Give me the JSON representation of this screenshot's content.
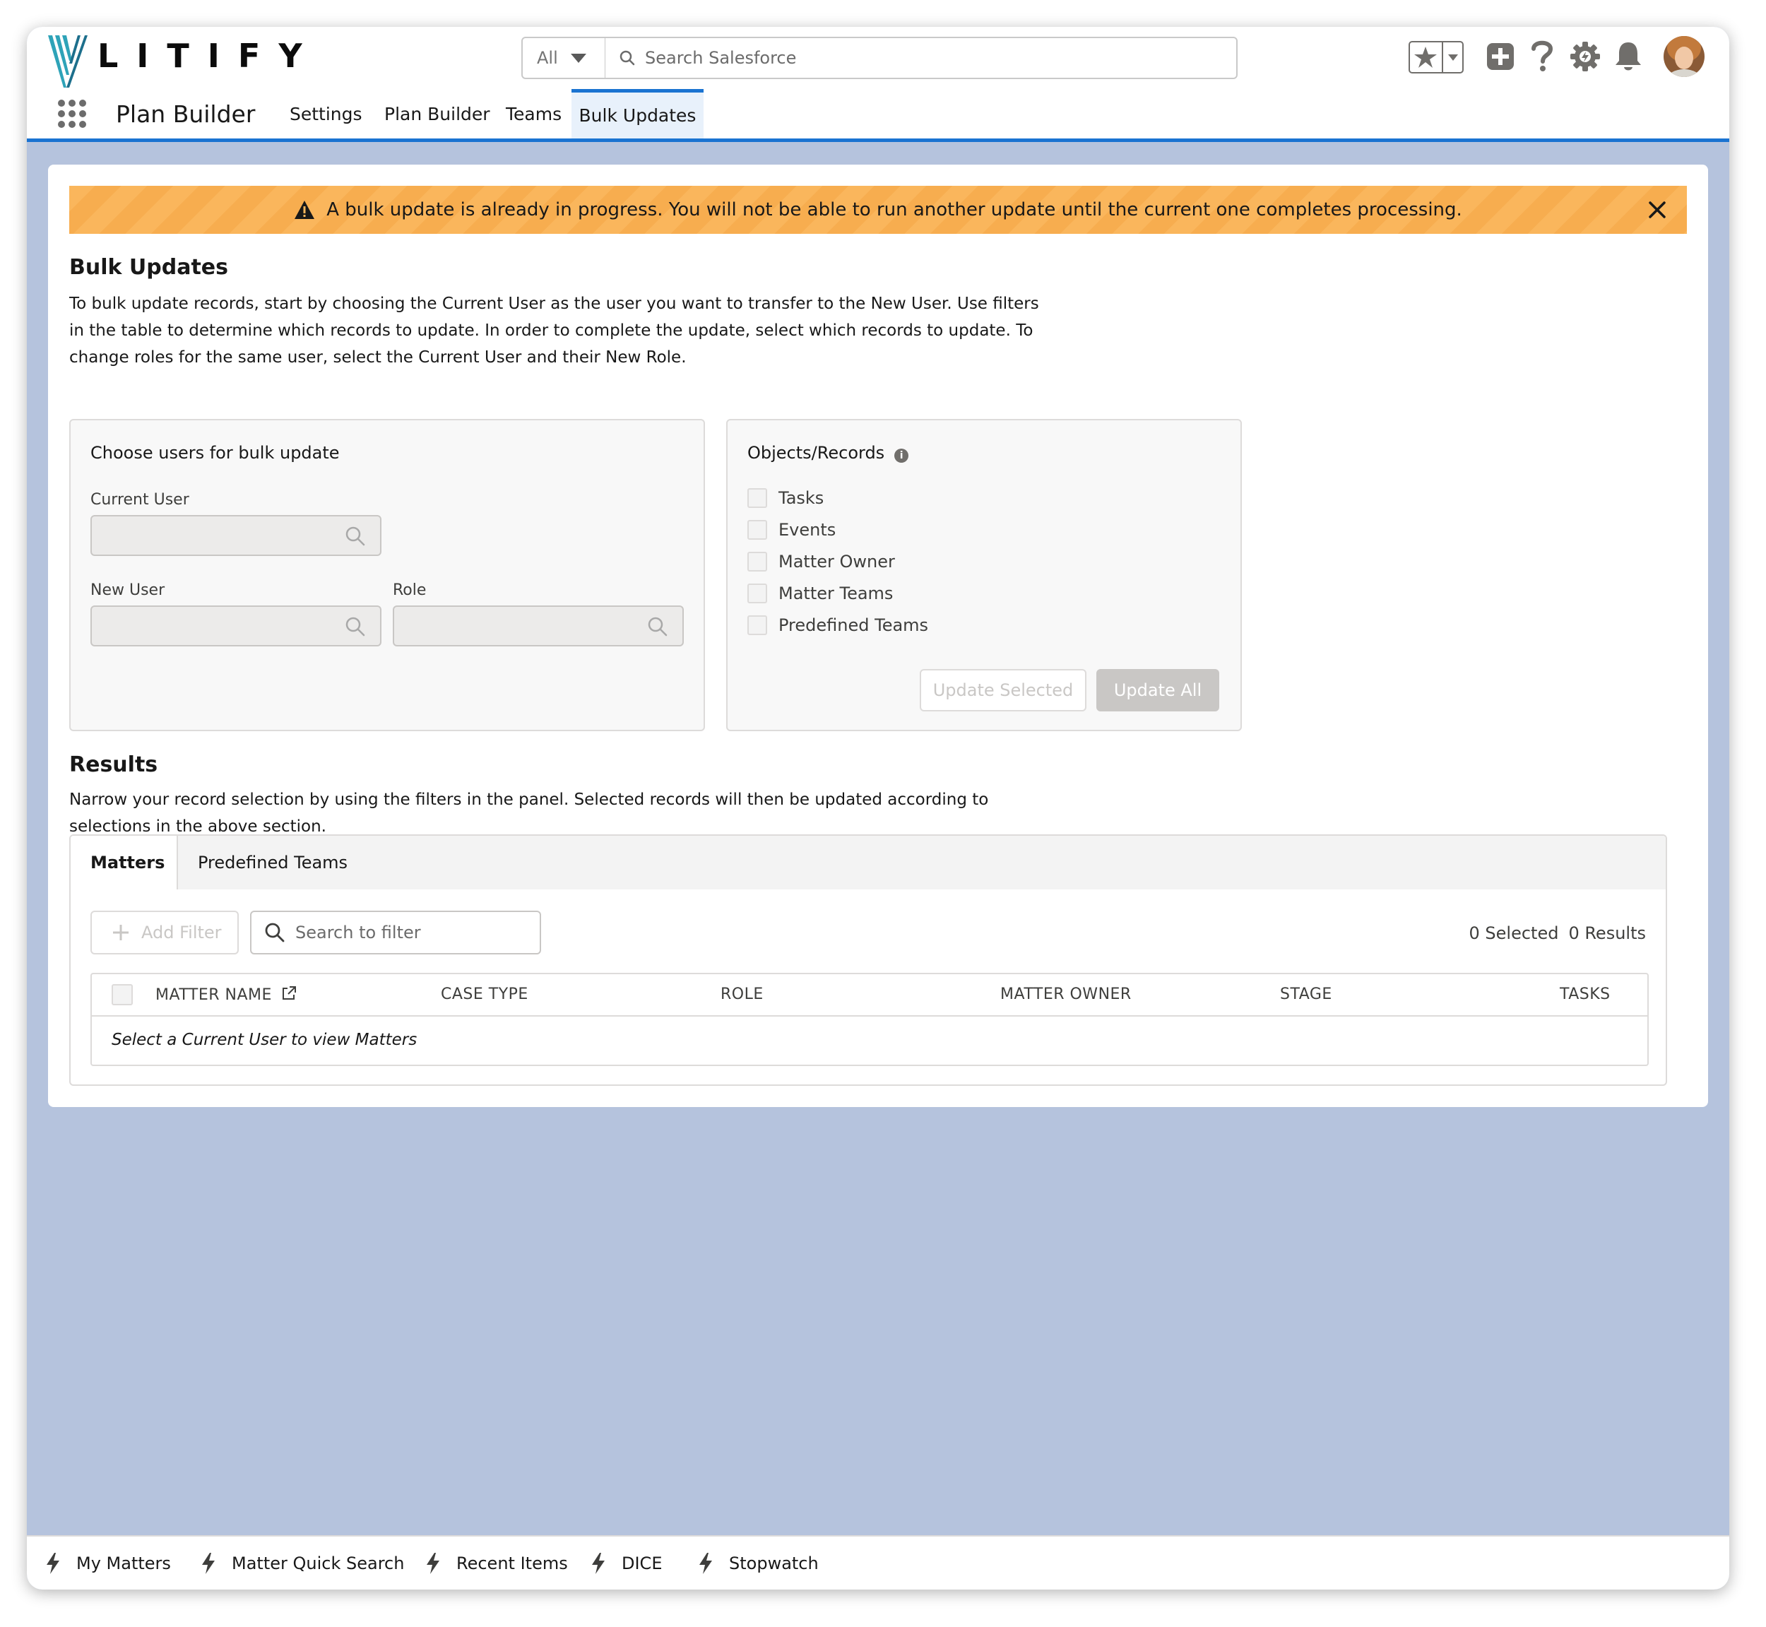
{
  "header": {
    "brand": "LITIFY",
    "search_scope": "All",
    "search_placeholder": "Search Salesforce",
    "icons": [
      "favorites-star-icon",
      "add-icon",
      "help-icon",
      "setup-gear-icon",
      "notifications-bell-icon",
      "user-avatar"
    ]
  },
  "nav": {
    "app_name": "Plan Builder",
    "items": [
      "Settings",
      "Plan Builder",
      "Teams",
      "Bulk Updates"
    ],
    "active": "Bulk Updates"
  },
  "banner": {
    "message": "A bulk update is already in progress. You will not be able to run another update until the current one completes processing.",
    "color": "#fab65c"
  },
  "bulk": {
    "title": "Bulk Updates",
    "description_lines": [
      "To bulk update records, start by choosing the Current User as the user you want to transfer to the New User. Use filters",
      "in the table to determine which records to update. In order to complete the update, select which records to update. To",
      "change roles for the same user, select the Current User and their New Role."
    ]
  },
  "users_panel": {
    "title": "Choose users for bulk update",
    "current_user_label": "Current User",
    "new_user_label": "New User",
    "role_label": "Role"
  },
  "objects_panel": {
    "title": "Objects/Records",
    "options": [
      "Tasks",
      "Events",
      "Matter Owner",
      "Matter Teams",
      "Predefined Teams"
    ],
    "update_selected": "Update Selected",
    "update_all": "Update All"
  },
  "results": {
    "title": "Results",
    "description_lines": [
      "Narrow your record selection by using the filters in the panel. Selected records will then be updated according to",
      "selections in the above section."
    ],
    "tabs": [
      "Matters",
      "Predefined Teams"
    ],
    "add_filter": "Add Filter",
    "filter_placeholder": "Search to filter",
    "selected_count": "0 Selected",
    "results_count": "0 Results",
    "columns": [
      "MATTER NAME",
      "CASE TYPE",
      "ROLE",
      "MATTER OWNER",
      "STAGE",
      "TASKS"
    ],
    "empty_message": "Select a Current User to view Matters"
  },
  "utility_bar": {
    "items": [
      "My Matters",
      "Matter Quick Search",
      "Recent Items",
      "DICE",
      "Stopwatch"
    ]
  },
  "colors": {
    "brand_blue": "#1a73d1",
    "logo_teal": "#2ea3b8",
    "page_background": "#b5c3dd"
  }
}
